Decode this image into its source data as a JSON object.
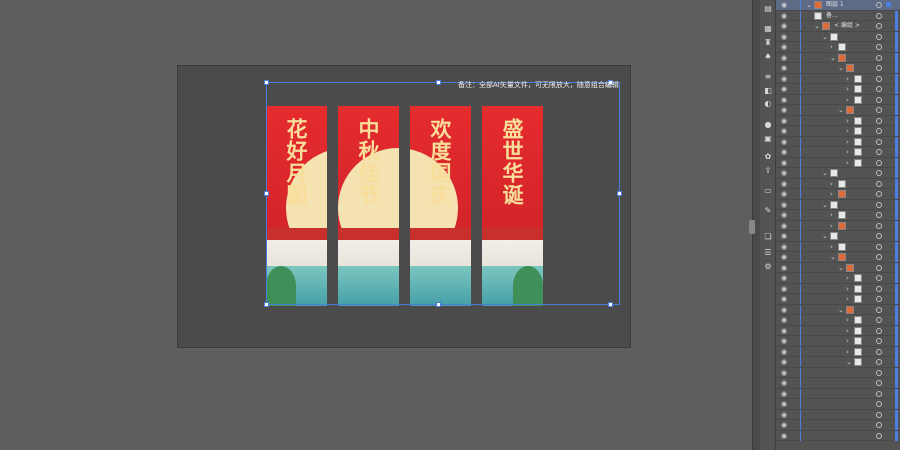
{
  "canvas": {
    "note": "备注：全部AI矢量文件，可无限放大，随意组合编辑"
  },
  "banners": [
    {
      "title": "花好月圆"
    },
    {
      "title": "中秋佳节"
    },
    {
      "title": "欢度国庆"
    },
    {
      "title": "盛世华诞"
    }
  ],
  "tools": {
    "icons": [
      "doc-icon",
      "grid-icon",
      "chess-icon",
      "spade-icon",
      "lines-icon",
      "transparency-icon",
      "gradient-icon",
      "circle-icon",
      "swatch-icon",
      "palette-icon",
      "export-icon",
      "artboard-icon",
      "comment-icon",
      "layers-icon",
      "align-icon",
      "properties-icon"
    ]
  },
  "layers": {
    "top": {
      "label": "图层 1"
    },
    "rows": [
      {
        "indent": 0,
        "thumb": "plain",
        "label": "备...",
        "chevron": ""
      },
      {
        "indent": 1,
        "thumb": "img",
        "label": "< 编组 >",
        "chevron": "⌄"
      },
      {
        "indent": 2,
        "thumb": "plain",
        "label": "",
        "chevron": "⌄"
      },
      {
        "indent": 3,
        "thumb": "plain",
        "label": "",
        "chevron": "›"
      },
      {
        "indent": 3,
        "thumb": "img",
        "label": "",
        "chevron": "⌄"
      },
      {
        "indent": 4,
        "thumb": "img",
        "label": "",
        "chevron": "⌄"
      },
      {
        "indent": 5,
        "thumb": "plain",
        "label": "",
        "chevron": "›"
      },
      {
        "indent": 5,
        "thumb": "plain",
        "label": "",
        "chevron": "›"
      },
      {
        "indent": 5,
        "thumb": "plain",
        "label": "",
        "chevron": "›"
      },
      {
        "indent": 4,
        "thumb": "img",
        "label": "",
        "chevron": "⌄"
      },
      {
        "indent": 5,
        "thumb": "plain",
        "label": "",
        "chevron": "›"
      },
      {
        "indent": 5,
        "thumb": "plain",
        "label": "",
        "chevron": "›"
      },
      {
        "indent": 5,
        "thumb": "plain",
        "label": "",
        "chevron": "›"
      },
      {
        "indent": 5,
        "thumb": "plain",
        "label": "",
        "chevron": "›"
      },
      {
        "indent": 5,
        "thumb": "plain",
        "label": "",
        "chevron": "›"
      },
      {
        "indent": 2,
        "thumb": "plain",
        "label": "",
        "chevron": "⌄"
      },
      {
        "indent": 3,
        "thumb": "plain",
        "label": "",
        "chevron": "›"
      },
      {
        "indent": 3,
        "thumb": "img",
        "label": "",
        "chevron": "›"
      },
      {
        "indent": 2,
        "thumb": "plain",
        "label": "",
        "chevron": "⌄"
      },
      {
        "indent": 3,
        "thumb": "plain",
        "label": "",
        "chevron": "›"
      },
      {
        "indent": 3,
        "thumb": "img",
        "label": "",
        "chevron": "›"
      },
      {
        "indent": 2,
        "thumb": "plain",
        "label": "",
        "chevron": "⌄"
      },
      {
        "indent": 3,
        "thumb": "plain",
        "label": "",
        "chevron": "›"
      },
      {
        "indent": 3,
        "thumb": "img",
        "label": "",
        "chevron": "⌄"
      },
      {
        "indent": 4,
        "thumb": "img",
        "label": "",
        "chevron": "⌄"
      },
      {
        "indent": 5,
        "thumb": "plain",
        "label": "",
        "chevron": "›"
      },
      {
        "indent": 5,
        "thumb": "plain",
        "label": "",
        "chevron": "›"
      },
      {
        "indent": 5,
        "thumb": "plain",
        "label": "",
        "chevron": "›"
      },
      {
        "indent": 4,
        "thumb": "img",
        "label": "",
        "chevron": "⌄"
      },
      {
        "indent": 5,
        "thumb": "plain",
        "label": "",
        "chevron": "›"
      },
      {
        "indent": 5,
        "thumb": "plain",
        "label": "",
        "chevron": "›"
      },
      {
        "indent": 5,
        "thumb": "plain",
        "label": "",
        "chevron": "›"
      },
      {
        "indent": 5,
        "thumb": "plain",
        "label": "",
        "chevron": "›"
      },
      {
        "indent": 5,
        "thumb": "plain",
        "label": "",
        "chevron": "⌄"
      },
      {
        "indent": 6,
        "thumb": "none",
        "label": "",
        "chevron": ""
      },
      {
        "indent": 6,
        "thumb": "none",
        "label": "",
        "chevron": ""
      },
      {
        "indent": 6,
        "thumb": "none",
        "label": "",
        "chevron": ""
      },
      {
        "indent": 6,
        "thumb": "none",
        "label": "",
        "chevron": ""
      },
      {
        "indent": 6,
        "thumb": "none",
        "label": "",
        "chevron": ""
      },
      {
        "indent": 6,
        "thumb": "none",
        "label": "",
        "chevron": ""
      },
      {
        "indent": 6,
        "thumb": "none",
        "label": "",
        "chevron": ""
      }
    ]
  },
  "colors": {
    "accent": "#4d7fe0",
    "banner_red": "#e52c2e",
    "gold_text": "#f9dd9a"
  }
}
